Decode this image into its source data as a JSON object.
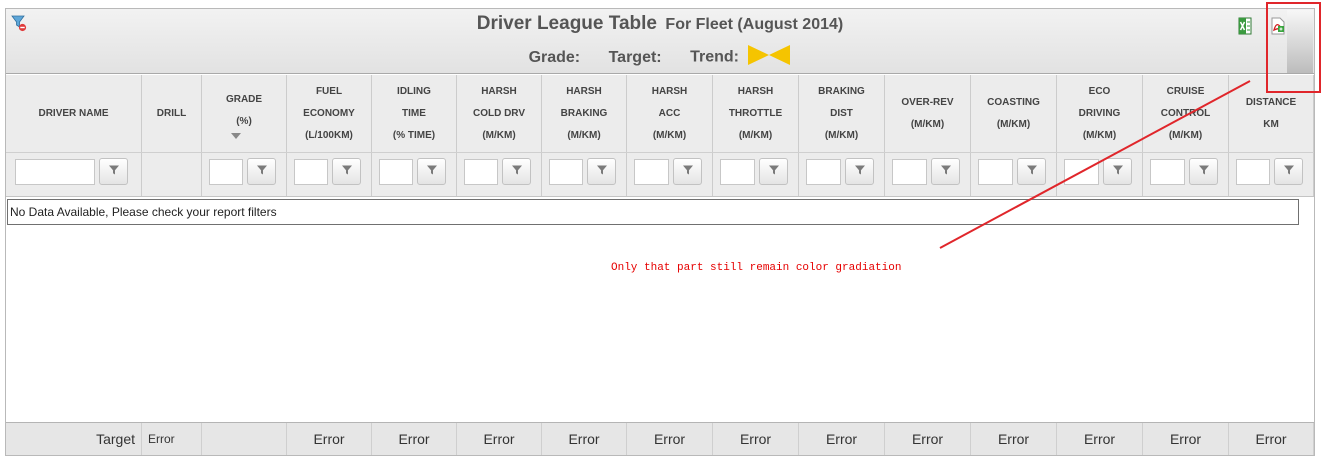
{
  "header": {
    "title": "Driver League Table",
    "subtitle": "For Fleet (August 2014)",
    "grade_label": "Grade:",
    "target_label": "Target:",
    "trend_label": "Trend:",
    "trend_color": "#f5c400"
  },
  "columns": [
    {
      "lines": [
        "DRIVER NAME"
      ],
      "filter": true
    },
    {
      "lines": [
        "DRILL"
      ],
      "filter": false
    },
    {
      "lines": [
        "GRADE",
        "(%)"
      ],
      "filter": true,
      "sorted": "desc"
    },
    {
      "lines": [
        "FUEL",
        "ECONOMY",
        "(L/100KM)"
      ],
      "filter": true
    },
    {
      "lines": [
        "IDLING",
        "TIME",
        "(% TIME)"
      ],
      "filter": true
    },
    {
      "lines": [
        "HARSH",
        "COLD DRV",
        "(M/KM)"
      ],
      "filter": true
    },
    {
      "lines": [
        "HARSH",
        "BRAKING",
        "(M/KM)"
      ],
      "filter": true
    },
    {
      "lines": [
        "HARSH",
        "ACC",
        "(M/KM)"
      ],
      "filter": true
    },
    {
      "lines": [
        "HARSH",
        "THROTTLE",
        "(M/KM)"
      ],
      "filter": true
    },
    {
      "lines": [
        "BRAKING",
        "DIST",
        "(M/KM)"
      ],
      "filter": true
    },
    {
      "lines": [
        "OVER-REV",
        "(M/KM)"
      ],
      "filter": true
    },
    {
      "lines": [
        "COASTING",
        "(M/KM)"
      ],
      "filter": true
    },
    {
      "lines": [
        "ECO",
        "DRIVING",
        "(M/KM)"
      ],
      "filter": true
    },
    {
      "lines": [
        "CRUISE",
        "CONTROL",
        "(M/KM)"
      ],
      "filter": true
    },
    {
      "lines": [
        "DISTANCE",
        "KM"
      ],
      "filter": true
    }
  ],
  "no_data_message": "No Data Available, Please check your report filters",
  "annotation": {
    "text": "Only that part still remain color gradiation",
    "color": "#e60000"
  },
  "footer": {
    "cells": [
      "Target",
      "Error",
      "",
      "Error",
      "Error",
      "Error",
      "Error",
      "Error",
      "Error",
      "Error",
      "Error",
      "Error",
      "Error",
      "Error",
      "Error"
    ]
  }
}
